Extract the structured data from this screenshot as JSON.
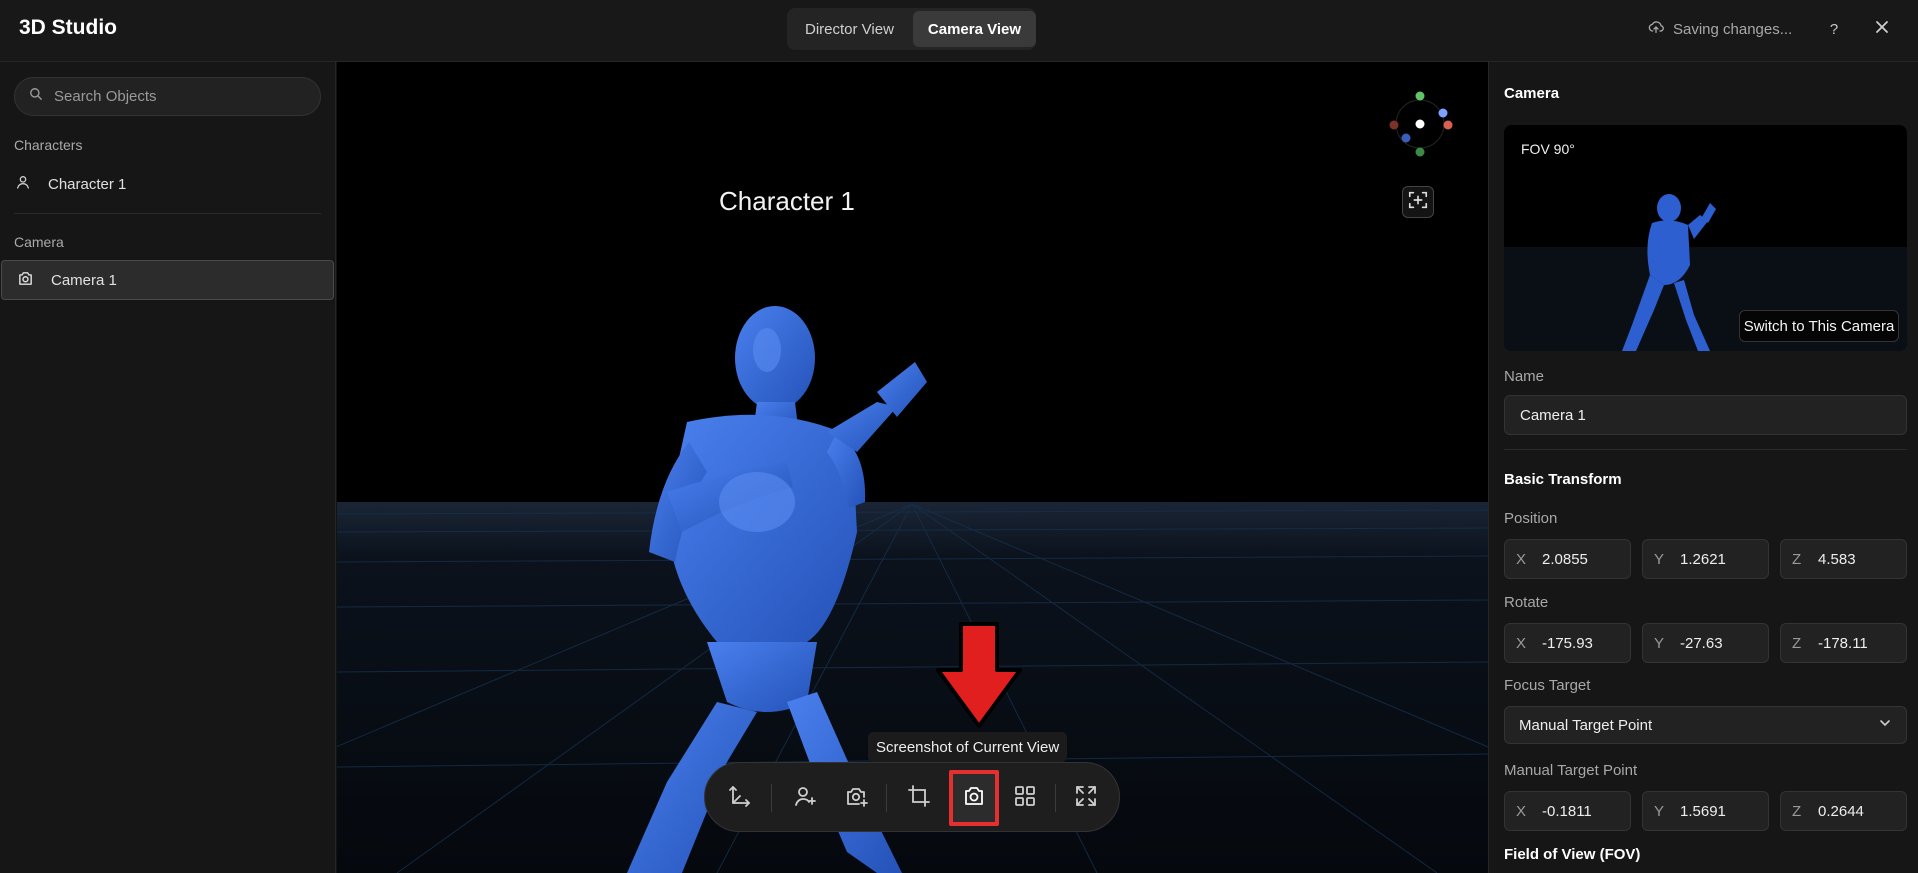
{
  "app": {
    "title": "3D Studio"
  },
  "header": {
    "views": [
      {
        "label": "Director View",
        "active": false
      },
      {
        "label": "Camera View",
        "active": true
      }
    ],
    "status": "Saving changes...",
    "help_label": "?"
  },
  "sidebar": {
    "search_placeholder": "Search Objects",
    "sections": [
      {
        "label": "Characters",
        "items": [
          {
            "label": "Character 1",
            "icon": "person-icon",
            "selected": false
          }
        ]
      },
      {
        "label": "Camera",
        "items": [
          {
            "label": "Camera 1",
            "icon": "camera-icon",
            "selected": true
          }
        ]
      }
    ]
  },
  "viewport": {
    "character_label": "Character 1",
    "tooltip": "Screenshot of Current View",
    "toolbar": [
      {
        "name": "axes-tool-button",
        "icon": "axes-icon"
      },
      {
        "name": "add-character-button",
        "icon": "person-add-icon"
      },
      {
        "name": "add-camera-button",
        "icon": "camera-add-icon"
      },
      {
        "name": "crop-button",
        "icon": "crop-icon"
      },
      {
        "name": "screenshot-button",
        "icon": "camera-icon",
        "highlighted": true
      },
      {
        "name": "grid-view-button",
        "icon": "grid-icon"
      },
      {
        "name": "fullscreen-button",
        "icon": "expand-icon"
      }
    ],
    "colors": {
      "figure": "#3467d6",
      "highlight": "#e53030",
      "arrow": "#e11f1f"
    }
  },
  "panel": {
    "heading": "Camera",
    "preview": {
      "fov_badge": "FOV 90°",
      "switch_label": "Switch to This Camera"
    },
    "name_label": "Name",
    "name_value": "Camera 1",
    "transform_heading": "Basic Transform",
    "position": {
      "label": "Position",
      "x": "2.0855",
      "y": "1.2621",
      "z": "4.583"
    },
    "rotate": {
      "label": "Rotate",
      "x": "-175.93",
      "y": "-27.63",
      "z": "-178.11"
    },
    "focus_label": "Focus Target",
    "focus_value": "Manual Target Point",
    "manual": {
      "label": "Manual Target Point",
      "x": "-0.1811",
      "y": "1.5691",
      "z": "0.2644"
    },
    "fov_label": "Field of View (FOV)",
    "axis_labels": {
      "x": "X",
      "y": "Y",
      "z": "Z"
    }
  }
}
